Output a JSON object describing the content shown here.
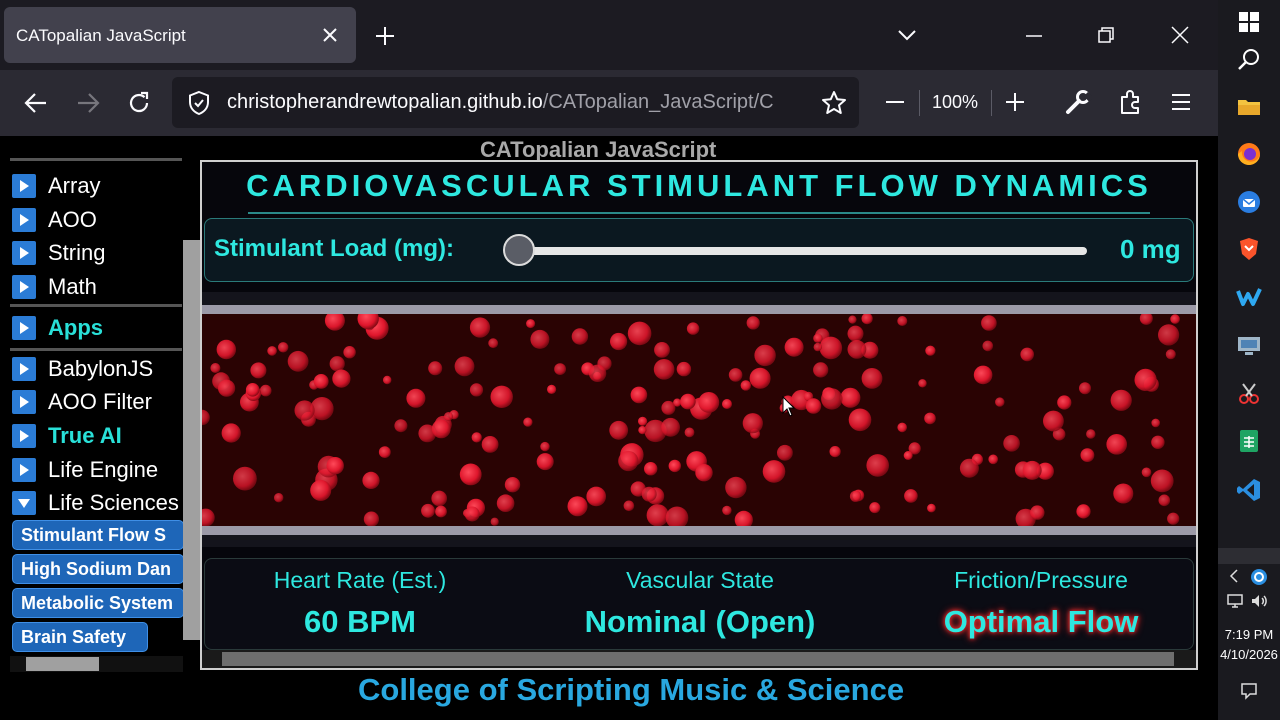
{
  "browser": {
    "tab_title": "CATopalian JavaScript",
    "url_host": "christopherandrewtopalian.github.io",
    "url_path": "/CATopalian_JavaScript/C",
    "zoom": "100%"
  },
  "page": {
    "header": "CATopalian JavaScript",
    "footer": "College of Scripting Music & Science"
  },
  "sidebar": {
    "items": [
      {
        "label": "Array",
        "highlight": false
      },
      {
        "label": "AOO",
        "highlight": false
      },
      {
        "label": "String",
        "highlight": false
      },
      {
        "label": "Math",
        "highlight": false
      },
      {
        "label": "Apps",
        "highlight": true
      },
      {
        "label": "BabylonJS",
        "highlight": false
      },
      {
        "label": "AOO Filter",
        "highlight": false
      },
      {
        "label": "True AI",
        "highlight": true
      },
      {
        "label": "Life Engine",
        "highlight": false
      },
      {
        "label": "Life Sciences",
        "highlight": false
      }
    ],
    "pills": [
      "Stimulant Flow S",
      "High Sodium Dan",
      "Metabolic System",
      "Brain Safety"
    ]
  },
  "sim": {
    "title": "CARDIOVASCULAR STIMULANT FLOW DYNAMICS",
    "load_label": "Stimulant Load (mg):",
    "load_value": "0 mg",
    "load_fraction": 0,
    "stats": [
      {
        "label": "Heart Rate (Est.)",
        "value": "60 BPM"
      },
      {
        "label": "Vascular State",
        "value": "Nominal (Open)"
      },
      {
        "label": "Friction/Pressure",
        "value": "Optimal Flow"
      }
    ]
  },
  "taskbar": {
    "time": "7:19 PM",
    "date": "4/10/2026"
  },
  "colors": {
    "accent_cyan": "#2ee8e0",
    "footer_blue": "#29a8e0",
    "blood_cell": "#e0162c",
    "vessel_bg": "#2a0303"
  }
}
